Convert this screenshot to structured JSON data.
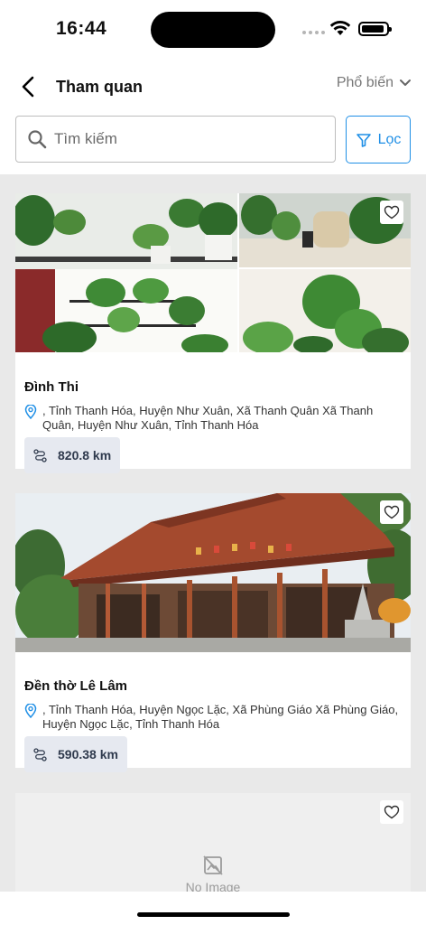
{
  "status": {
    "time": "16:44"
  },
  "header": {
    "title": "Tham quan",
    "sort_label": "Phổ biến"
  },
  "search": {
    "placeholder": "Tìm kiếm",
    "filter_label": "Lọc"
  },
  "places": [
    {
      "name": "Đình Thi",
      "address": ", Tỉnh Thanh Hóa, Huyện Như Xuân, Xã Thanh Quân  Xã Thanh Quân, Huyện Như Xuân, Tỉnh Thanh Hóa",
      "distance": "820.8 km"
    },
    {
      "name": "Đền thờ Lê Lâm",
      "address": ", Tỉnh Thanh Hóa, Huyện Ngọc Lặc, Xã Phùng Giáo  Xã Phùng Giáo, Huyện Ngọc Lặc, Tỉnh Thanh Hóa",
      "distance": "590.38 km"
    },
    {
      "no_image_label": "No Image"
    }
  ],
  "colors": {
    "accent": "#1f8fe6",
    "list_bg": "#e9e9e9",
    "chip_bg": "#e6e9f0"
  }
}
